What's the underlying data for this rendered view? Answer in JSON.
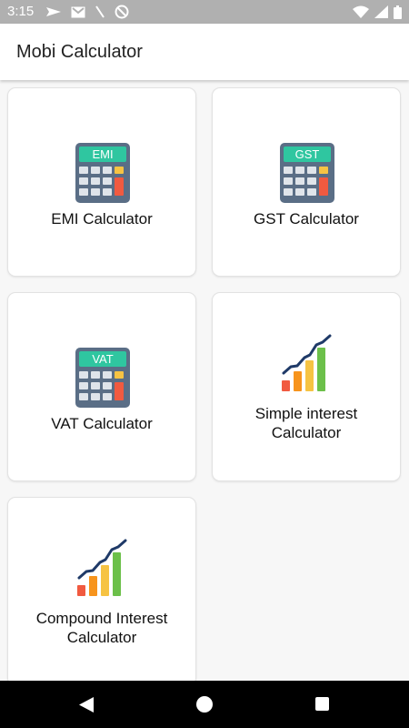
{
  "status_bar": {
    "time": "3:15",
    "left_icons": [
      "send-icon",
      "mail-icon",
      "slash-icon",
      "sync-off-icon"
    ],
    "right_icons": [
      "wifi-icon",
      "cell-signal-icon",
      "battery-icon"
    ]
  },
  "app_bar": {
    "title": "Mobi Calculator"
  },
  "cards": [
    {
      "title": "EMI Calculator",
      "icon": "calculator-icon",
      "icon_text": "EMI"
    },
    {
      "title": "GST Calculator",
      "icon": "calculator-icon",
      "icon_text": "GST"
    },
    {
      "title": "VAT Calculator",
      "icon": "calculator-icon",
      "icon_text": "VAT"
    },
    {
      "title_lines": [
        "Simple interest",
        "Calculator"
      ],
      "icon": "growth-chart-icon"
    },
    {
      "title_lines": [
        "Compound Interest",
        "Calculator"
      ],
      "icon": "growth-chart-icon"
    }
  ],
  "nav_bar": {
    "buttons": [
      "back-button",
      "home-button",
      "recents-button"
    ]
  },
  "colors": {
    "status_bar": "#b0b0b0",
    "calculator_body": "#5a6e86",
    "calculator_screen": "#2fc6a0",
    "key_accent": "#f15a40",
    "nav_bar": "#000000"
  }
}
